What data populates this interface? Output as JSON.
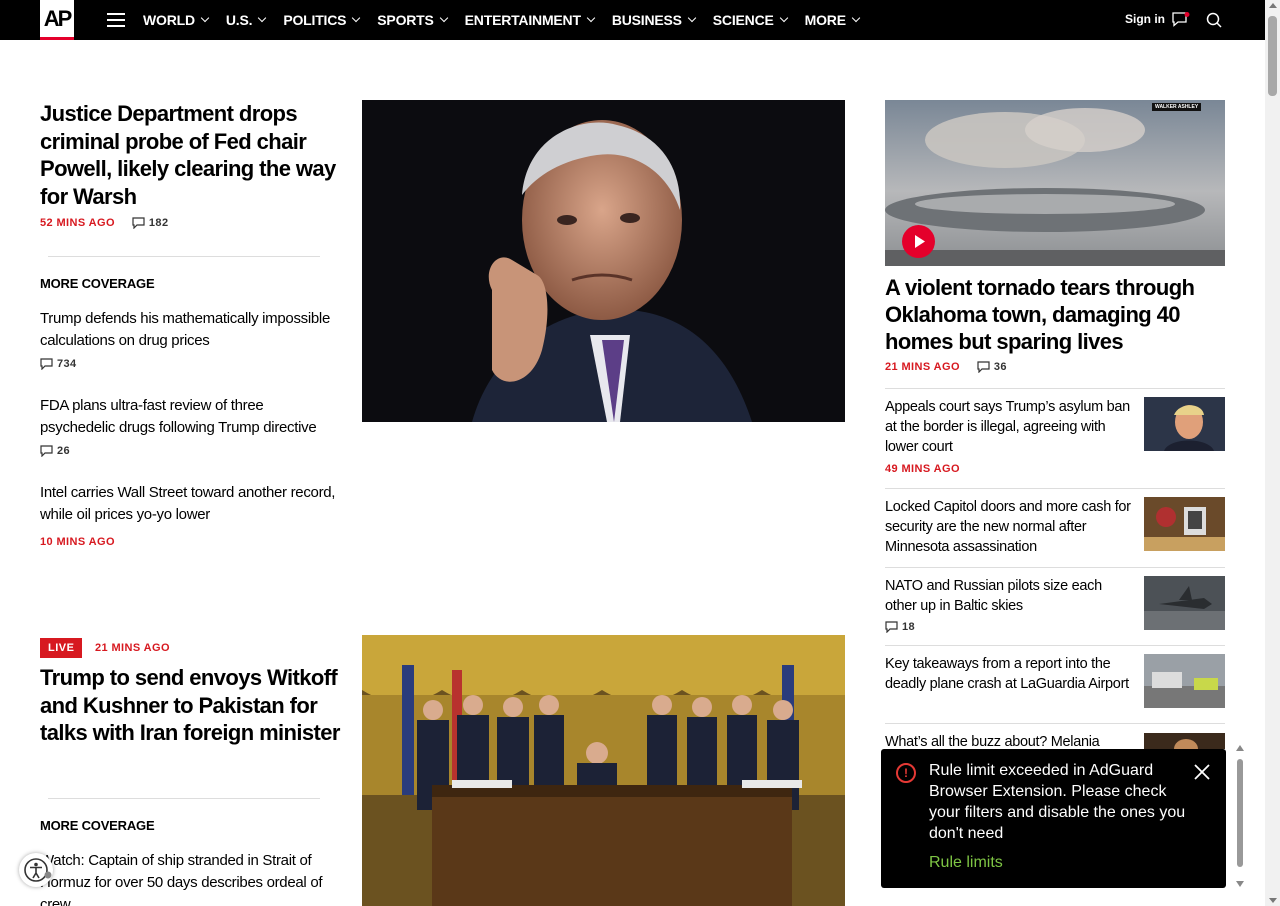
{
  "nav": {
    "logo": "AP",
    "items": [
      "WORLD",
      "U.S.",
      "POLITICS",
      "SPORTS",
      "ENTERTAINMENT",
      "BUSINESS",
      "SCIENCE",
      "MORE"
    ],
    "signin": "Sign in"
  },
  "lead": {
    "headline": "Justice Department drops criminal probe of Fed chair Powell, likely clearing the way for Warsh",
    "time": "52 MINS AGO",
    "comments": "182",
    "more_coverage": "MORE COVERAGE",
    "sub_stories": [
      {
        "title": "Trump defends his mathematically impossible calculations on drug prices",
        "comments": "734"
      },
      {
        "title": "FDA plans ultra-fast review of three psychedelic drugs following Trump directive",
        "comments": "26"
      },
      {
        "title": "Intel carries Wall Street toward another record, while oil prices yo-yo lower",
        "time": "10 MINS AGO"
      }
    ]
  },
  "second": {
    "badge": "LIVE",
    "time": "21 MINS AGO",
    "headline": "Trump to send envoys Witkoff and Kushner to Pakistan for talks with Iran foreign minister",
    "more_coverage": "MORE COVERAGE",
    "sub_story": "Watch: Captain of ship stranded in Strait of Hormuz for over 50 days describes ordeal of crew"
  },
  "right": {
    "video_credit": "WALKER ASHLEY",
    "headline": "A violent tornado tears through Oklahoma town, damaging 40 homes but sparing lives",
    "time": "21 MINS AGO",
    "comments": "36",
    "stories": [
      {
        "title": "Appeals court says Trump’s asylum ban at the border is illegal, agreeing with lower court",
        "time": "49 MINS AGO"
      },
      {
        "title": "Locked Capitol doors and more cash for security are the new normal after Minnesota assassination"
      },
      {
        "title": "NATO and Russian pilots size each other up in Baltic skies",
        "comments": "18"
      },
      {
        "title": "Key takeaways from a report into the deadly plane crash at LaGuardia Airport"
      },
      {
        "title": "What’s all the buzz about? Melania"
      }
    ]
  },
  "toast": {
    "message": "Rule limit exceeded in AdGuard Browser Extension. Please check your filters and disable the ones you don't need",
    "link": "Rule limits",
    "icon": "!"
  },
  "colors": {
    "accent": "#d71920",
    "nav_bg": "#000000",
    "toast_link": "#7ec544"
  }
}
